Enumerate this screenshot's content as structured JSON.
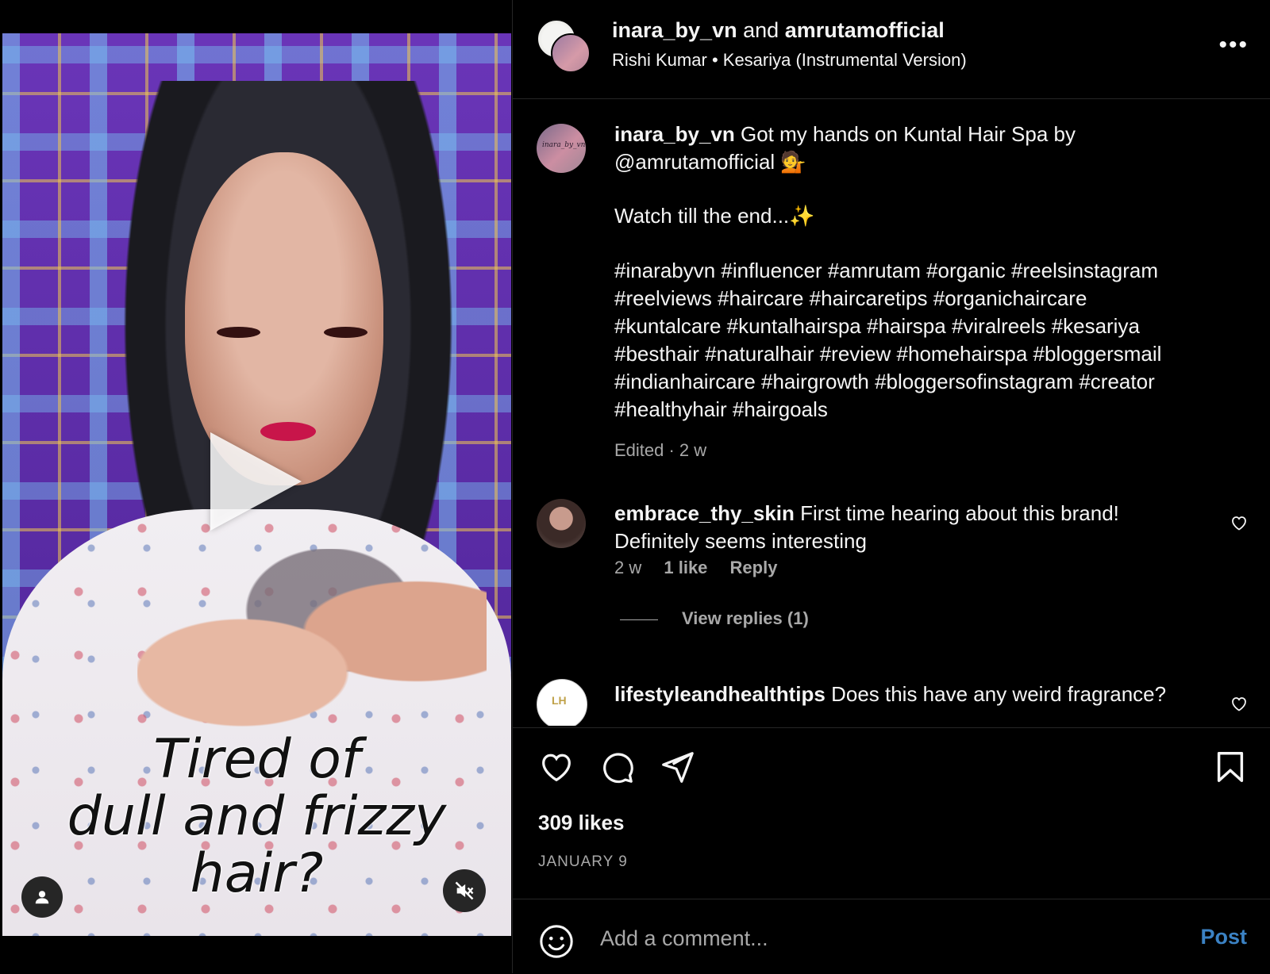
{
  "video": {
    "overlay_text": "Tired of\ndull and frizzy\nhair?"
  },
  "header": {
    "user1": "inara_by_vn",
    "joiner": "and",
    "user2": "amrutamofficial",
    "audio_artist": "Rishi Kumar",
    "audio_separator": "•",
    "audio_title": "Kesariya (Instrumental Version)"
  },
  "caption": {
    "username": "inara_by_vn",
    "line1": "Got my hands on Kuntal Hair Spa by",
    "line2": "@amrutamofficial 💁",
    "line3": "Watch till the end...✨",
    "hashtags": [
      "#inarabyvn #influencer #amrutam #organic #reelsinstagram",
      "#reelviews #haircare #haircaretips #organichaircare",
      "#kuntalcare #kuntalhairspa #hairspa #viralreels #kesariya",
      "#besthair #naturalhair #review #homehairspa #bloggersmail",
      "#indianhaircare #hairgrowth #bloggersofinstagram #creator",
      "#healthyhair #hairgoals"
    ],
    "meta": "Edited · 2 w"
  },
  "comments": [
    {
      "username": "embrace_thy_skin",
      "text": "First time hearing about this brand!",
      "text2": "Definitely seems interesting",
      "time": "2 w",
      "likes": "1 like",
      "reply": "Reply",
      "view_replies": "View replies (1)"
    },
    {
      "username": "lifestyleandhealthtips",
      "text": "Does this have any weird fragrance?"
    }
  ],
  "actions": {
    "likes": "309 likes",
    "date": "JANUARY 9"
  },
  "comment_box": {
    "placeholder": "Add a comment...",
    "post_label": "Post",
    "post_color": "#3b82c4"
  },
  "icons": [
    "heart-icon",
    "comment-icon",
    "share-icon",
    "bookmark-icon",
    "emoji-icon",
    "more-icon",
    "play-icon",
    "user-tag-icon",
    "mute-icon"
  ]
}
